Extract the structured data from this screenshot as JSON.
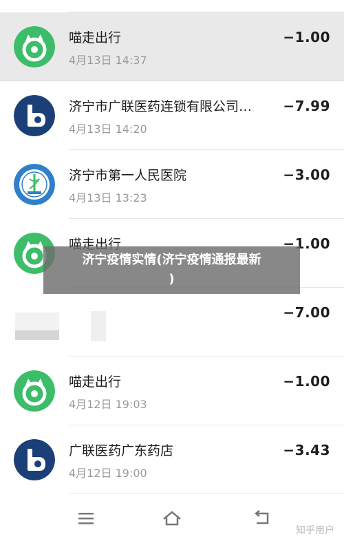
{
  "transactions": [
    {
      "title": "喵走出行",
      "time": "4月13日 14:37",
      "amount": "−1.00",
      "icon": "meow-travel-icon",
      "highlighted": true
    },
    {
      "title": "济宁市广联医药连锁有限公司…",
      "time": "4月13日 14:20",
      "amount": "−7.99",
      "icon": "guanglian-pharmacy-icon"
    },
    {
      "title": "济宁市第一人民医院",
      "time": "4月13日 13:23",
      "amount": "−3.00",
      "icon": "hospital-seal-icon"
    },
    {
      "title": "喵走出行",
      "time": "",
      "amount": "−1.00",
      "icon": "meow-travel-icon"
    },
    {
      "title": "",
      "time": "",
      "amount": "−7.00",
      "icon": "blurred-placeholder"
    },
    {
      "title": "喵走出行",
      "time": "4月12日 19:03",
      "amount": "−1.00",
      "icon": "meow-travel-icon"
    },
    {
      "title": "广联医药广东药店",
      "time": "4月12日 19:00",
      "amount": "−3.43",
      "icon": "guanglian-pharmacy-icon"
    }
  ],
  "overlay": {
    "text": "济宁疫情实情(济宁疫情通报最新\n)"
  },
  "nav": {
    "menu_icon": "menu-icon",
    "home_icon": "home-icon",
    "back_icon": "back-icon"
  },
  "watermark": "知乎用户",
  "colors": {
    "meow_green": "#3dbd6a",
    "pharmacy_navy": "#1b3f77",
    "hospital_blue": "#2f7fc9"
  }
}
